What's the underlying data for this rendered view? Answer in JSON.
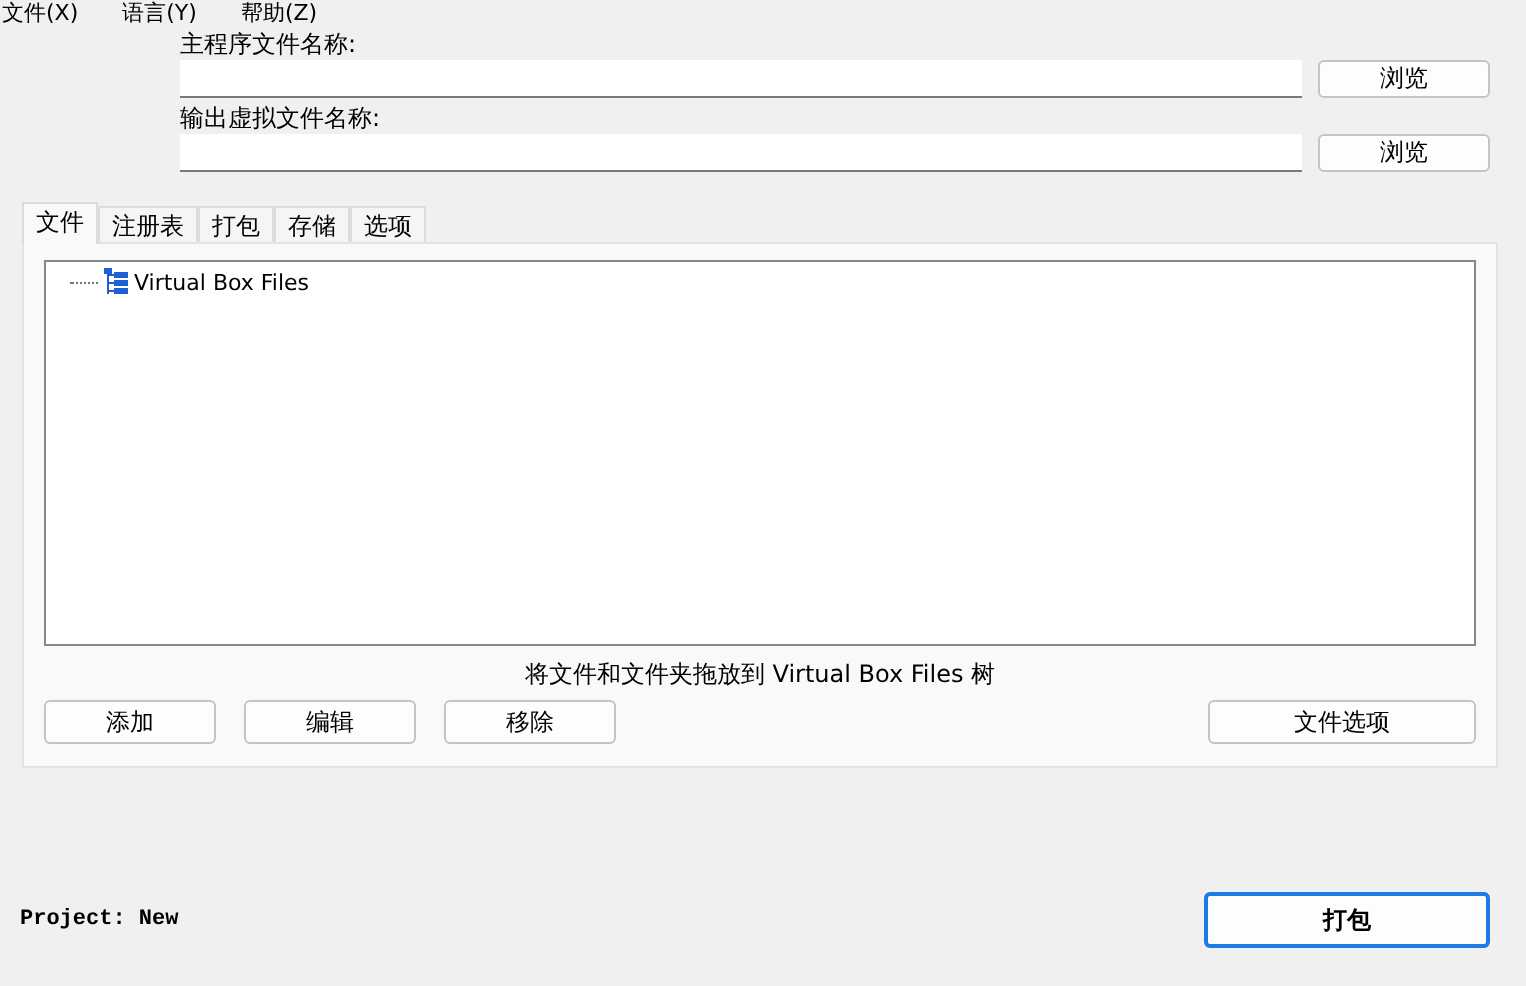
{
  "menu": [
    "文件(X)",
    "语言(Y)",
    "帮助(Z)"
  ],
  "fields": [
    {
      "label": "主程序文件名称:",
      "button": "浏览"
    },
    {
      "label": "输出虚拟文件名称:",
      "button": "浏览"
    }
  ],
  "tabs": [
    {
      "label": "文件",
      "selected": true
    },
    {
      "label": "注册表",
      "selected": false
    },
    {
      "label": "打包",
      "selected": false
    },
    {
      "label": "存储",
      "selected": false
    },
    {
      "label": "选项",
      "selected": false
    }
  ],
  "tree": [
    {
      "label": "Virtual Box Files"
    }
  ],
  "hint": "将文件和文件夹拖放到 Virtual Box Files 树",
  "actions": [
    "添加",
    "编辑",
    "移除"
  ],
  "file_options": "文件选项",
  "project": "Project: New",
  "build_button": "打包"
}
